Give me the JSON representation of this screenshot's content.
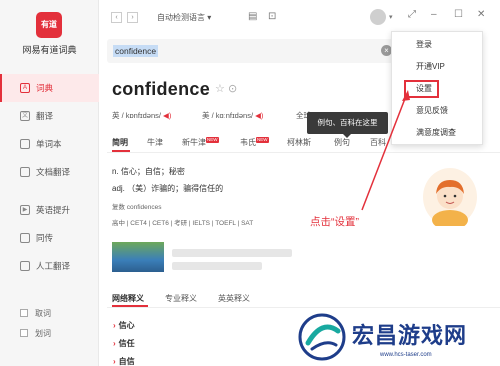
{
  "app": {
    "logo_text": "有道",
    "name": "网易有道词典"
  },
  "sidebar": {
    "items": [
      {
        "label": "词典",
        "icon": "dictionary-icon",
        "active": true
      },
      {
        "label": "翻译",
        "icon": "translate-icon"
      },
      {
        "label": "单词本",
        "icon": "wordbook-icon"
      },
      {
        "label": "文档翻译",
        "icon": "document-icon"
      },
      {
        "label": "英语提升",
        "icon": "improve-icon"
      },
      {
        "label": "同传",
        "icon": "interpret-icon"
      },
      {
        "label": "人工翻译",
        "icon": "human-translate-icon"
      }
    ],
    "bottom": [
      {
        "label": "取词"
      },
      {
        "label": "划词"
      }
    ]
  },
  "topbar": {
    "language": "自动检测语言"
  },
  "search": {
    "value": "confidence"
  },
  "entry": {
    "word": "confidence",
    "uk_label": "英 / kɒnfɪdəns/",
    "us_label": "美 / kɑːnfɪdəns/",
    "more": "全球",
    "tabs": [
      "简明",
      "牛津",
      "新牛津",
      "韦氏",
      "柯林斯",
      "例句",
      "百科"
    ],
    "new_badge": "NEW",
    "tooltip": "例句、百科在这里",
    "definitions": [
      "n. 信心；自信；秘密",
      "adj. （美）诈骗的；骗得信任的"
    ],
    "plural": "复数 confidences",
    "exams": "高中 | CET4 | CET6 | 考研 | IELTS | TOEFL | SAT",
    "meaning_tabs": [
      "网络释义",
      "专业释义",
      "英英释义"
    ],
    "meanings": [
      "信心",
      "信任",
      "自信"
    ]
  },
  "menu": {
    "items": [
      "登录",
      "开通VIP",
      "设置",
      "意见反馈",
      "满意度调查"
    ]
  },
  "annotation": "点击“设置”",
  "watermark": {
    "text": "宏昌游戏网",
    "url": "www.hcs-taser.com"
  },
  "colors": {
    "accent": "#e3303b",
    "highlight": "#c6dcf5",
    "tooltip": "#3a3a3a",
    "watermark": "#1e3d8a"
  }
}
